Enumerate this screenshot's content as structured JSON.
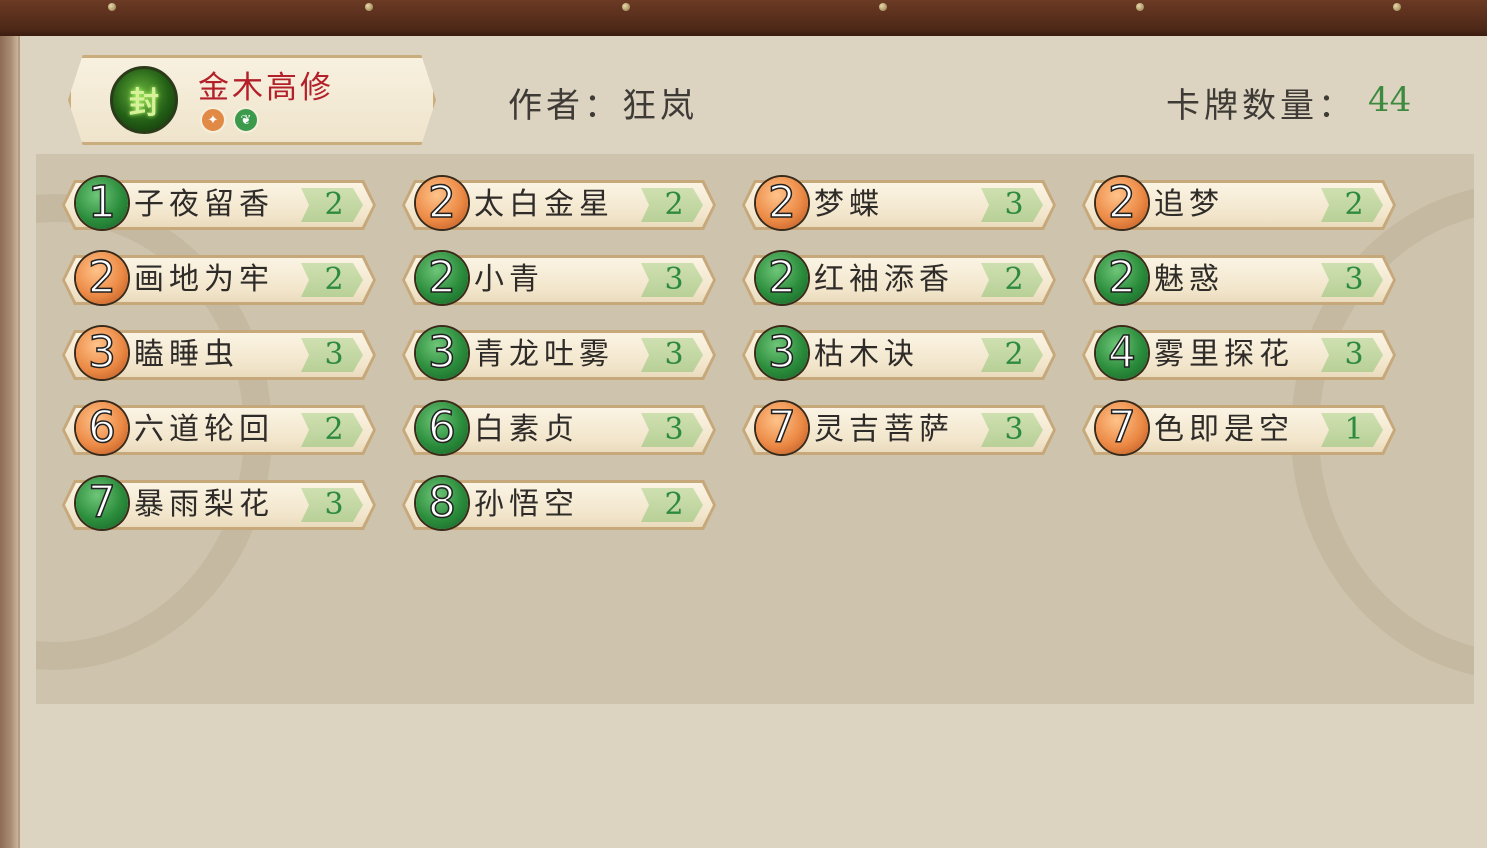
{
  "deck": {
    "name": "金木高修",
    "seal_char": "封",
    "author_label": "作者：狂岚",
    "card_count_label": "卡牌数量：",
    "card_count": "44",
    "elements": [
      {
        "icon": "fire-element-icon",
        "glyph": "✦",
        "color": "#e18a45"
      },
      {
        "icon": "wood-element-icon",
        "glyph": "❦",
        "color": "#3c9a4d"
      }
    ]
  },
  "cards": [
    {
      "cost": "1",
      "cost_color": "green",
      "name": "子夜留香",
      "count": "2"
    },
    {
      "cost": "2",
      "cost_color": "orange",
      "name": "太白金星",
      "count": "2"
    },
    {
      "cost": "2",
      "cost_color": "orange",
      "name": "梦蝶",
      "count": "3"
    },
    {
      "cost": "2",
      "cost_color": "orange",
      "name": "追梦",
      "count": "2"
    },
    {
      "cost": "2",
      "cost_color": "orange",
      "name": "画地为牢",
      "count": "2"
    },
    {
      "cost": "2",
      "cost_color": "green",
      "name": "小青",
      "count": "3"
    },
    {
      "cost": "2",
      "cost_color": "green",
      "name": "红袖添香",
      "count": "2"
    },
    {
      "cost": "2",
      "cost_color": "green",
      "name": "魅惑",
      "count": "3"
    },
    {
      "cost": "3",
      "cost_color": "orange",
      "name": "瞌睡虫",
      "count": "3"
    },
    {
      "cost": "3",
      "cost_color": "green",
      "name": "青龙吐雾",
      "count": "3"
    },
    {
      "cost": "3",
      "cost_color": "green",
      "name": "枯木诀",
      "count": "2"
    },
    {
      "cost": "4",
      "cost_color": "green",
      "name": "雾里探花",
      "count": "3"
    },
    {
      "cost": "6",
      "cost_color": "orange",
      "name": "六道轮回",
      "count": "2"
    },
    {
      "cost": "6",
      "cost_color": "green",
      "name": "白素贞",
      "count": "3"
    },
    {
      "cost": "7",
      "cost_color": "orange",
      "name": "灵吉菩萨",
      "count": "3"
    },
    {
      "cost": "7",
      "cost_color": "orange",
      "name": "色即是空",
      "count": "1"
    },
    {
      "cost": "7",
      "cost_color": "green",
      "name": "暴雨梨花",
      "count": "3"
    },
    {
      "cost": "8",
      "cost_color": "green",
      "name": "孙悟空",
      "count": "2"
    }
  ]
}
